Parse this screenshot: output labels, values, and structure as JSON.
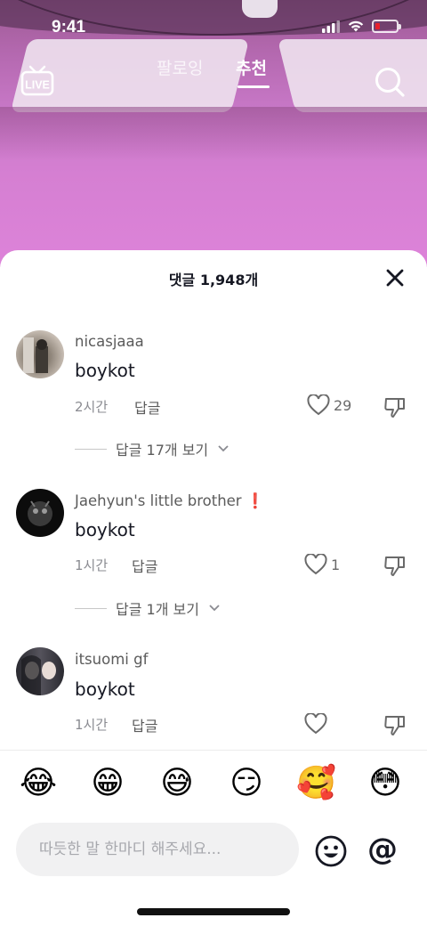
{
  "status_bar": {
    "time": "9:41"
  },
  "top_nav": {
    "live_label": "LIVE",
    "tabs": [
      {
        "label": "팔로잉",
        "active": false
      },
      {
        "label": "추천",
        "active": true
      }
    ]
  },
  "comments_sheet": {
    "title": "댓글 1,948개",
    "comments": [
      {
        "username": "nicasjaaa",
        "text": "boykot",
        "time": "2시간",
        "reply_label": "답글",
        "likes": "29",
        "view_replies": "답글 17개 보기"
      },
      {
        "username": "Jaehyun's little brother",
        "username_badge": "❗",
        "text": "boykot",
        "time": "1시간",
        "reply_label": "답글",
        "likes": "1",
        "view_replies": "답글 1개 보기"
      },
      {
        "username": "itsuomi gf",
        "text": "boykot",
        "time": "1시간",
        "reply_label": "답글",
        "likes": ""
      }
    ]
  },
  "emoji_bar": [
    "😂",
    "😁",
    "😅",
    "😏",
    "🥰",
    "😳"
  ],
  "input": {
    "placeholder": "따듯한 말 한마디 해주세요...",
    "value": ""
  },
  "at_symbol": "@",
  "colors": {
    "accent_red": "#e3242b",
    "text_primary": "#161823",
    "text_secondary": "#8a8b91"
  }
}
